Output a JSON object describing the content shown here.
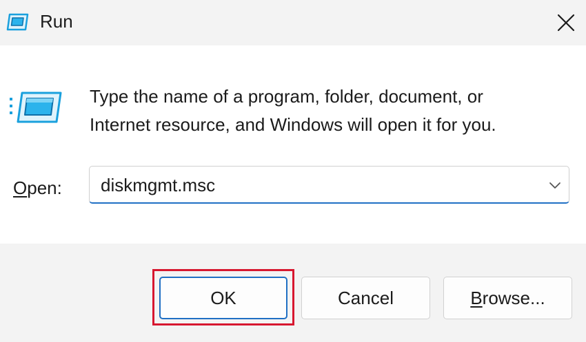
{
  "window": {
    "title": "Run",
    "icon": "run-icon",
    "close_icon": "close-icon"
  },
  "content": {
    "description_line1": "Type the name of a program, folder, document, or",
    "description_line2": "Internet resource, and Windows will open it for you.",
    "open_label_accel": "O",
    "open_label_rest": "pen:",
    "open_value": "diskmgmt.msc",
    "dropdown_icon": "chevron-down-icon"
  },
  "buttons": {
    "ok": "OK",
    "cancel": "Cancel",
    "browse_accel": "B",
    "browse_rest": "rowse..."
  },
  "annotation": {
    "highlight_color": "#d7172f",
    "target": "ok-button"
  },
  "colors": {
    "accent": "#1f6fc4",
    "titlebar_bg": "#f3f3f3",
    "footer_bg": "#f3f3f3",
    "text": "#1b1b1b"
  }
}
